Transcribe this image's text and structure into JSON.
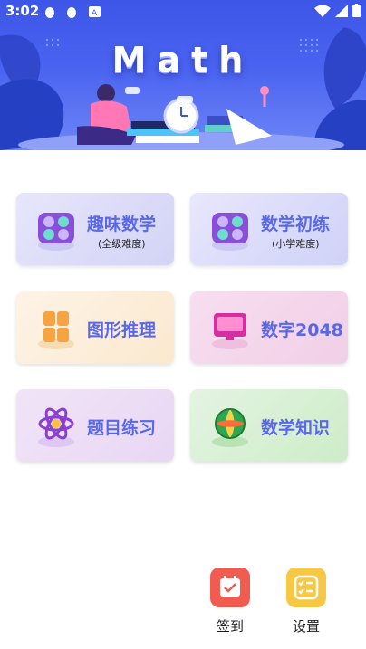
{
  "status_bar": {
    "time": "3:02"
  },
  "banner": {
    "title": "Math"
  },
  "tiles": [
    {
      "label": "趣味数学",
      "sub": "(全级难度)",
      "icon": "calculator-icon"
    },
    {
      "label": "数学初练",
      "sub": "(小学难度)",
      "icon": "calculator-icon"
    },
    {
      "label": "图形推理",
      "icon": "shapes-grid-icon"
    },
    {
      "label": "数字2048",
      "icon": "monitor-icon"
    },
    {
      "label": "题目练习",
      "icon": "atom-icon"
    },
    {
      "label": "数学知识",
      "icon": "globe-icon"
    }
  ],
  "bottom_nav": {
    "checkin_label": "签到",
    "settings_label": "设置"
  }
}
